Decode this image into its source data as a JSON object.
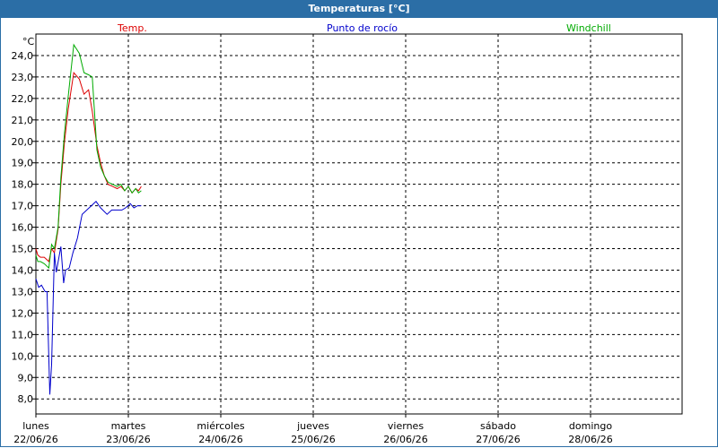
{
  "window": {
    "title": "Temperaturas [°C]"
  },
  "colors": {
    "titlebar": "#2b6ea6",
    "grid": "#000000"
  },
  "chart_data": {
    "type": "line",
    "title": "Temperaturas [°C]",
    "yunit": "°C",
    "ylim": [
      7.3,
      25.0
    ],
    "yticks": [
      "8,0",
      "9,0",
      "10,0",
      "11,0",
      "12,0",
      "13,0",
      "14,0",
      "15,0",
      "16,0",
      "17,0",
      "18,0",
      "19,0",
      "20,0",
      "21,0",
      "22,0",
      "23,0",
      "24,0"
    ],
    "xlim": [
      0,
      7
    ],
    "xticks": [
      {
        "day": "lunes",
        "date": "22/06/26"
      },
      {
        "day": "martes",
        "date": "23/06/26"
      },
      {
        "day": "miércoles",
        "date": "24/06/26"
      },
      {
        "day": "jueves",
        "date": "25/06/26"
      },
      {
        "day": "viernes",
        "date": "26/06/26"
      },
      {
        "day": "sábado",
        "date": "27/06/26"
      },
      {
        "day": "domingo",
        "date": "28/06/26"
      }
    ],
    "grid": true,
    "legend_placement": "top",
    "series": [
      {
        "name": "Temp.",
        "color": "#dd0000",
        "x": [
          0,
          0.02,
          0.05,
          0.09,
          0.14,
          0.17,
          0.2,
          0.24,
          0.27,
          0.31,
          0.35,
          0.41,
          0.47,
          0.52,
          0.57,
          0.61,
          0.66,
          0.7,
          0.74,
          0.78,
          0.83,
          0.88,
          0.92,
          0.96,
          1.0,
          1.04,
          1.08,
          1.11,
          1.14
        ],
        "y": [
          15.0,
          14.7,
          14.6,
          14.6,
          14.4,
          15.0,
          14.8,
          15.9,
          18.0,
          20.0,
          21.5,
          23.2,
          22.9,
          22.2,
          22.4,
          21.4,
          19.8,
          19.0,
          18.4,
          18.0,
          17.9,
          17.8,
          17.9,
          17.7,
          17.9,
          17.6,
          17.8,
          17.7,
          17.9
        ]
      },
      {
        "name": "Punto de rocío",
        "color": "#0000cc",
        "x": [
          0,
          0.03,
          0.06,
          0.1,
          0.12,
          0.15,
          0.17,
          0.2,
          0.22,
          0.27,
          0.3,
          0.32,
          0.36,
          0.4,
          0.45,
          0.5,
          0.55,
          0.6,
          0.65,
          0.7,
          0.77,
          0.82,
          0.87,
          0.93,
          0.97,
          1.02,
          1.06,
          1.1,
          1.14
        ],
        "y": [
          13.6,
          13.2,
          13.3,
          13.0,
          13.0,
          8.2,
          9.6,
          14.8,
          13.9,
          15.1,
          13.4,
          14.0,
          14.1,
          14.8,
          15.5,
          16.6,
          16.8,
          17.0,
          17.2,
          16.9,
          16.6,
          16.8,
          16.8,
          16.8,
          16.9,
          17.1,
          16.9,
          17.0,
          17.0
        ]
      },
      {
        "name": "Windchill",
        "color": "#00aa00",
        "x": [
          0,
          0.02,
          0.05,
          0.09,
          0.14,
          0.17,
          0.2,
          0.24,
          0.27,
          0.31,
          0.35,
          0.41,
          0.47,
          0.52,
          0.57,
          0.61,
          0.66,
          0.7,
          0.74,
          0.78,
          0.83,
          0.88,
          0.92,
          0.96,
          1.0,
          1.04,
          1.08,
          1.11,
          1.14
        ],
        "y": [
          14.7,
          14.4,
          14.4,
          14.3,
          14.1,
          15.2,
          15.0,
          16.0,
          18.3,
          20.4,
          22.1,
          24.5,
          24.1,
          23.2,
          23.1,
          23.0,
          19.6,
          18.8,
          18.4,
          18.1,
          18.0,
          17.9,
          18.0,
          17.7,
          17.9,
          17.6,
          17.8,
          17.6,
          17.7
        ]
      }
    ]
  }
}
